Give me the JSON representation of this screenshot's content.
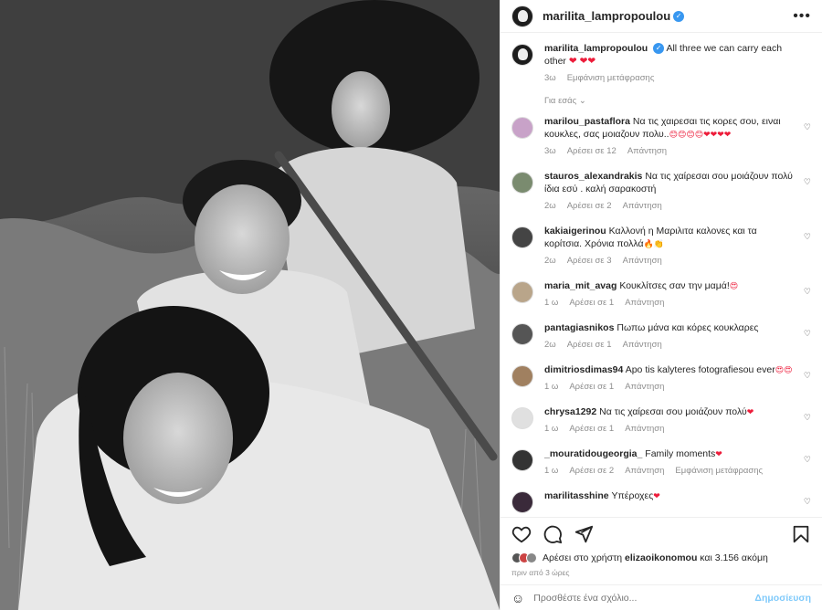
{
  "post": {
    "username": "marilita_lampropoulou",
    "caption": "All three we can carry each other",
    "caption_hearts": "❤ ❤❤",
    "caption_age": "3ω",
    "caption_translate": "Εμφάνιση μετάφρασης"
  },
  "for_you_label": "Για εσάς",
  "comments": [
    {
      "user": "marilou_pastaflora",
      "text": "Να τις χαιρεσαι τις κορες σου, ειναι κουκλες, σας μοιαζουν πολυ..",
      "emoji": "😊😊😊😊❤❤❤❤",
      "age": "3ω",
      "likes": "Αρέσει σε 12",
      "reply": "Απάντηση"
    },
    {
      "user": "stauros_alexandrakis",
      "text": "Να τις χαίρεσαι σου μοιάζουν πολύ ίδια εσύ . καλή σαρακοστή",
      "emoji": "",
      "age": "2ω",
      "likes": "Αρέσει σε 2",
      "reply": "Απάντηση"
    },
    {
      "user": "kakiaigerinou",
      "text": "Καλλονή η Μαριλιτα καλονες και τα κορίτσια. Χρόνια πολλά",
      "emoji": "🔥👏",
      "age": "2ω",
      "likes": "Αρέσει σε 3",
      "reply": "Απάντηση"
    },
    {
      "user": "maria_mit_avag",
      "text": "Κουκλίτσες σαν την μαμά!",
      "emoji": "😍",
      "age": "1 ω",
      "likes": "Αρέσει σε 1",
      "reply": "Απάντηση"
    },
    {
      "user": "pantagiasnikos",
      "text": "Πωπω μάνα και κόρες κουκλαρες",
      "emoji": "",
      "age": "2ω",
      "likes": "Αρέσει σε 1",
      "reply": "Απάντηση"
    },
    {
      "user": "dimitriosdimas94",
      "text": "Apo tis kalyteres fotografiesou ever",
      "emoji": "😍😍",
      "age": "1 ω",
      "likes": "Αρέσει σε 1",
      "reply": "Απάντηση"
    },
    {
      "user": "chrysa1292",
      "text": "Να τις χαίρεσαι σου μοιάζουν πολύ",
      "emoji": "❤",
      "age": "1 ω",
      "likes": "Αρέσει σε 1",
      "reply": "Απάντηση"
    },
    {
      "user": "_mouratidougeorgia_",
      "text": "Family moments",
      "emoji": "❤",
      "age": "1 ω",
      "likes": "Αρέσει σε 2",
      "reply": "Απάντηση",
      "extra": "Εμφάνιση μετάφρασης"
    },
    {
      "user": "marilitasshine",
      "text": "Υπέροχες",
      "emoji": "❤",
      "age": "",
      "likes": "",
      "reply": ""
    }
  ],
  "likes_line": {
    "prefix": "Αρέσει στο χρήστη",
    "user": "elizaoikonomou",
    "suffix": "και 3.156 ακόμη"
  },
  "posted_when": "πριν από 3 ώρες",
  "add_comment": {
    "placeholder": "Προσθέστε ένα σχόλιο...",
    "post_label": "Δημοσίευση"
  },
  "icons": [
    "heart-icon",
    "comment-icon",
    "share-icon",
    "save-icon",
    "emoji-icon",
    "more-icon"
  ]
}
